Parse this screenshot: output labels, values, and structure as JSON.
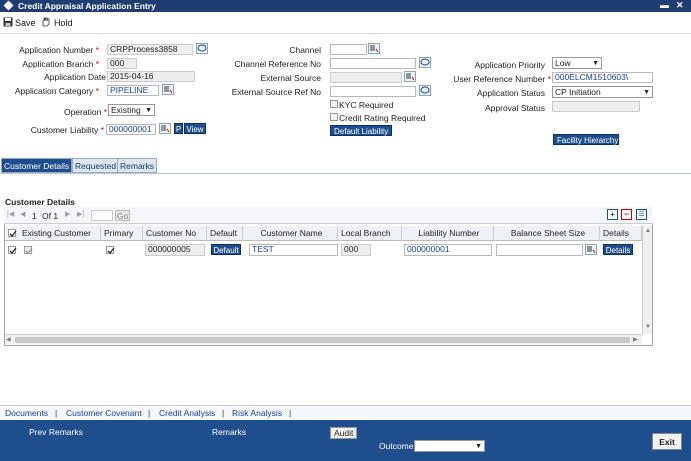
{
  "window": {
    "title": "Credit Appraisal Application Entry",
    "min_icon": "minimize-icon",
    "close_icon": "close-icon",
    "min_glyph": "▬",
    "close_glyph": "✕"
  },
  "toolbar": {
    "save_label": "Save",
    "hold_label": "Hold"
  },
  "form": {
    "application_number_label": "Application Number",
    "application_number": "CRPProcess3858",
    "application_branch_label": "Application Branch",
    "application_branch": "000",
    "application_date_label": "Application Date",
    "application_date": "2015-04-16",
    "application_category_label": "Application Category",
    "application_category": "PIPELINE",
    "operation_label": "Operation",
    "operation": "Existing",
    "customer_liability_label": "Customer Liability",
    "customer_liability": "000000001",
    "p_label": "P",
    "view_label": "View",
    "channel_label": "Channel",
    "channel_ref_label": "Channel Reference No",
    "external_source_label": "External Source",
    "external_source_ref_label": "External Source Ref No",
    "kyc_label": "KYC Required",
    "credit_rating_label": "Credit Rating Required",
    "default_liability_label": "Default Liability",
    "priority_label": "Application Priority",
    "priority": "Low",
    "user_ref_label": "User Reference Number",
    "user_ref": "000ELCM1510603\\",
    "status_label": "Application Status",
    "status": "CP Initiation",
    "approval_status_label": "Approval Status",
    "facility_hierarchy_label": "Facility Hierarchy",
    "required_mark": "*"
  },
  "tabs": [
    {
      "label": "Customer Details"
    },
    {
      "label": "Requested"
    },
    {
      "label": "Remarks"
    }
  ],
  "customer_details": {
    "title": "Customer Details",
    "pager": {
      "page": "1",
      "of_label": "Of 1",
      "go_label": "Go"
    },
    "columns": [
      "Existing Customer",
      "Primary",
      "Customer No",
      "Default",
      "Customer Name",
      "Local Branch",
      "Liability Number",
      "Balance Sheet Size",
      "Details"
    ],
    "rows": [
      {
        "customer_no": "000000005",
        "default_label": "Default",
        "customer_name": "TEST",
        "local_branch": "000",
        "liability_number": "000000001",
        "balance_sheet_size": "",
        "details_label": "Details"
      }
    ]
  },
  "footer_links": [
    "Documents",
    "Customer Covenant",
    "Credit Analysis",
    "Risk Analysis"
  ],
  "link_separator": "|",
  "footer": {
    "prev_remarks": "Prev Remarks",
    "remarks": "Remarks",
    "audit": "Audit",
    "outcome_label": "Outcome",
    "exit_label": "Exit"
  }
}
